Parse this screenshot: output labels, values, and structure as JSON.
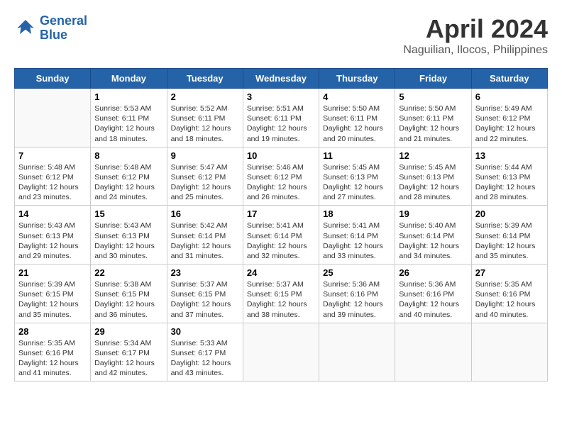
{
  "header": {
    "logo_line1": "General",
    "logo_line2": "Blue",
    "month": "April 2024",
    "location": "Naguilian, Ilocos, Philippines"
  },
  "weekdays": [
    "Sunday",
    "Monday",
    "Tuesday",
    "Wednesday",
    "Thursday",
    "Friday",
    "Saturday"
  ],
  "weeks": [
    [
      {
        "date": "",
        "info": ""
      },
      {
        "date": "1",
        "info": "Sunrise: 5:53 AM\nSunset: 6:11 PM\nDaylight: 12 hours\nand 18 minutes."
      },
      {
        "date": "2",
        "info": "Sunrise: 5:52 AM\nSunset: 6:11 PM\nDaylight: 12 hours\nand 18 minutes."
      },
      {
        "date": "3",
        "info": "Sunrise: 5:51 AM\nSunset: 6:11 PM\nDaylight: 12 hours\nand 19 minutes."
      },
      {
        "date": "4",
        "info": "Sunrise: 5:50 AM\nSunset: 6:11 PM\nDaylight: 12 hours\nand 20 minutes."
      },
      {
        "date": "5",
        "info": "Sunrise: 5:50 AM\nSunset: 6:11 PM\nDaylight: 12 hours\nand 21 minutes."
      },
      {
        "date": "6",
        "info": "Sunrise: 5:49 AM\nSunset: 6:12 PM\nDaylight: 12 hours\nand 22 minutes."
      }
    ],
    [
      {
        "date": "7",
        "info": "Sunrise: 5:48 AM\nSunset: 6:12 PM\nDaylight: 12 hours\nand 23 minutes."
      },
      {
        "date": "8",
        "info": "Sunrise: 5:48 AM\nSunset: 6:12 PM\nDaylight: 12 hours\nand 24 minutes."
      },
      {
        "date": "9",
        "info": "Sunrise: 5:47 AM\nSunset: 6:12 PM\nDaylight: 12 hours\nand 25 minutes."
      },
      {
        "date": "10",
        "info": "Sunrise: 5:46 AM\nSunset: 6:12 PM\nDaylight: 12 hours\nand 26 minutes."
      },
      {
        "date": "11",
        "info": "Sunrise: 5:45 AM\nSunset: 6:13 PM\nDaylight: 12 hours\nand 27 minutes."
      },
      {
        "date": "12",
        "info": "Sunrise: 5:45 AM\nSunset: 6:13 PM\nDaylight: 12 hours\nand 28 minutes."
      },
      {
        "date": "13",
        "info": "Sunrise: 5:44 AM\nSunset: 6:13 PM\nDaylight: 12 hours\nand 28 minutes."
      }
    ],
    [
      {
        "date": "14",
        "info": "Sunrise: 5:43 AM\nSunset: 6:13 PM\nDaylight: 12 hours\nand 29 minutes."
      },
      {
        "date": "15",
        "info": "Sunrise: 5:43 AM\nSunset: 6:13 PM\nDaylight: 12 hours\nand 30 minutes."
      },
      {
        "date": "16",
        "info": "Sunrise: 5:42 AM\nSunset: 6:14 PM\nDaylight: 12 hours\nand 31 minutes."
      },
      {
        "date": "17",
        "info": "Sunrise: 5:41 AM\nSunset: 6:14 PM\nDaylight: 12 hours\nand 32 minutes."
      },
      {
        "date": "18",
        "info": "Sunrise: 5:41 AM\nSunset: 6:14 PM\nDaylight: 12 hours\nand 33 minutes."
      },
      {
        "date": "19",
        "info": "Sunrise: 5:40 AM\nSunset: 6:14 PM\nDaylight: 12 hours\nand 34 minutes."
      },
      {
        "date": "20",
        "info": "Sunrise: 5:39 AM\nSunset: 6:14 PM\nDaylight: 12 hours\nand 35 minutes."
      }
    ],
    [
      {
        "date": "21",
        "info": "Sunrise: 5:39 AM\nSunset: 6:15 PM\nDaylight: 12 hours\nand 35 minutes."
      },
      {
        "date": "22",
        "info": "Sunrise: 5:38 AM\nSunset: 6:15 PM\nDaylight: 12 hours\nand 36 minutes."
      },
      {
        "date": "23",
        "info": "Sunrise: 5:37 AM\nSunset: 6:15 PM\nDaylight: 12 hours\nand 37 minutes."
      },
      {
        "date": "24",
        "info": "Sunrise: 5:37 AM\nSunset: 6:15 PM\nDaylight: 12 hours\nand 38 minutes."
      },
      {
        "date": "25",
        "info": "Sunrise: 5:36 AM\nSunset: 6:16 PM\nDaylight: 12 hours\nand 39 minutes."
      },
      {
        "date": "26",
        "info": "Sunrise: 5:36 AM\nSunset: 6:16 PM\nDaylight: 12 hours\nand 40 minutes."
      },
      {
        "date": "27",
        "info": "Sunrise: 5:35 AM\nSunset: 6:16 PM\nDaylight: 12 hours\nand 40 minutes."
      }
    ],
    [
      {
        "date": "28",
        "info": "Sunrise: 5:35 AM\nSunset: 6:16 PM\nDaylight: 12 hours\nand 41 minutes."
      },
      {
        "date": "29",
        "info": "Sunrise: 5:34 AM\nSunset: 6:17 PM\nDaylight: 12 hours\nand 42 minutes."
      },
      {
        "date": "30",
        "info": "Sunrise: 5:33 AM\nSunset: 6:17 PM\nDaylight: 12 hours\nand 43 minutes."
      },
      {
        "date": "",
        "info": ""
      },
      {
        "date": "",
        "info": ""
      },
      {
        "date": "",
        "info": ""
      },
      {
        "date": "",
        "info": ""
      }
    ]
  ]
}
